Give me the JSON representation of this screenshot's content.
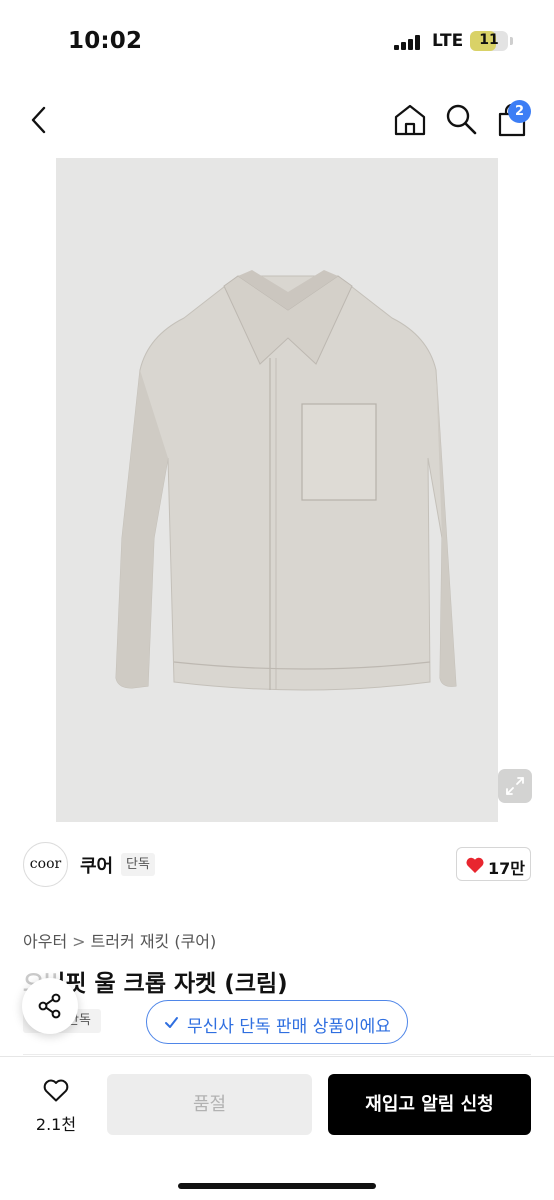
{
  "status_bar": {
    "time": "10:02",
    "network": "LTE",
    "battery_level": "11"
  },
  "nav": {
    "cart_count": "2"
  },
  "product_image": {
    "description_icon": "cream-cropped-jacket-photo",
    "background_color": "#e6e6e5",
    "garment_color": "#d9d6d0"
  },
  "brand": {
    "logo_text": "coor",
    "name": "쿠어",
    "exclusive_badge": "단독",
    "like_count": "17만"
  },
  "breadcrumb": {
    "category": "아우터",
    "separator": ">",
    "subcategory": "트러커 재킷 (쿠어)"
  },
  "product": {
    "title": "오버핏 울 크롭 자켓 (크림)",
    "tag": "단독"
  },
  "exclusive_notice": {
    "text": "무신사 단독 판매 상품이에요",
    "color": "#2f6fe0"
  },
  "bottom_bar": {
    "wish_count": "2.1천",
    "soldout_label": "품절",
    "restock_label": "재입고 알림 신청"
  }
}
